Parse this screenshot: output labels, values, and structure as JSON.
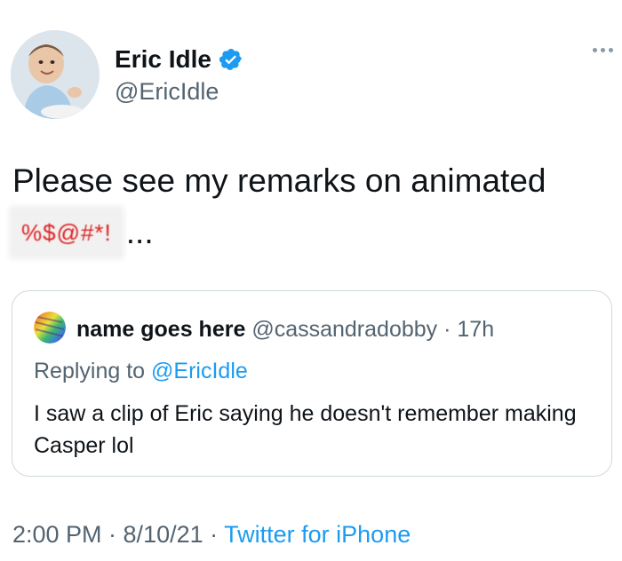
{
  "tweet": {
    "author": {
      "display_name": "Eric Idle",
      "handle": "@EricIdle",
      "verified": true,
      "verified_icon": "verified-badge-icon",
      "avatar": "baby-photo-avatar"
    },
    "more_icon": "more-options-icon",
    "text_line1": "Please see my remarks on animated",
    "censored": "%$@#*!",
    "ellipsis": "...",
    "quoted_tweet": {
      "display_name": "name goes here",
      "handle": "@cassandradobby",
      "separator": "·",
      "time": "17h",
      "replying_prefix": "Replying to ",
      "replying_to": "@EricIdle",
      "text": "I saw a clip of Eric saying he doesn't remember making Casper lol"
    },
    "timestamp": "2:00 PM · 8/10/21 · ",
    "source": "Twitter for iPhone"
  },
  "colors": {
    "link": "#1d9bf0",
    "secondary_text": "#536471",
    "border": "#cfd9de",
    "censor_text": "#e02020"
  }
}
